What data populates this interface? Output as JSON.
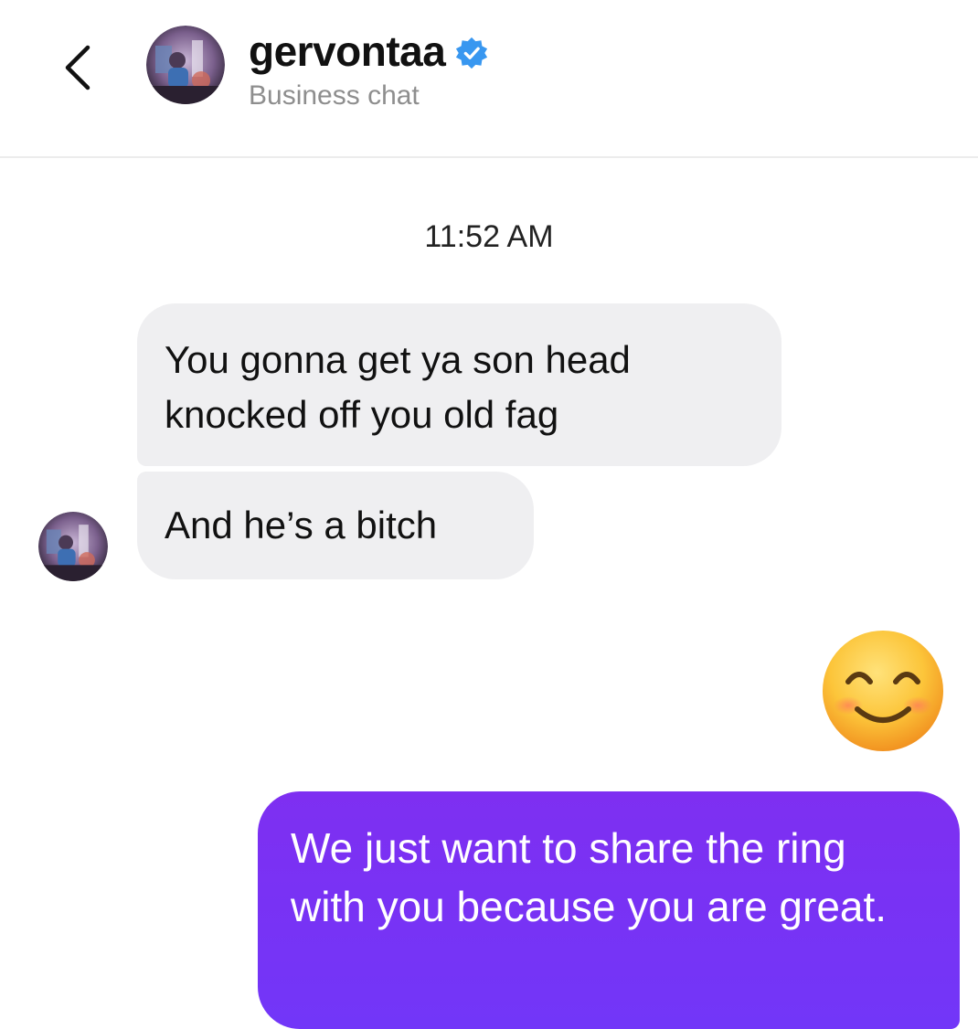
{
  "header": {
    "username": "gervontaa",
    "subtitle": "Business chat"
  },
  "chat": {
    "timestamp": "11:52 AM",
    "incoming": [
      "You gonna get ya son head knocked off you old fag",
      "And he’s a bitch"
    ],
    "outgoing_emoji": "😊",
    "outgoing": "We just want to share the ring with you because you are great."
  },
  "colors": {
    "incoming_bubble": "#efeff1",
    "outgoing_bubble": "#7a32f5",
    "verified_badge": "#3897f0",
    "subtitle_text": "#8e8e8e"
  },
  "icons": {
    "back": "chevron-left-icon",
    "verified": "verified-badge-icon",
    "avatar": "profile-avatar"
  }
}
